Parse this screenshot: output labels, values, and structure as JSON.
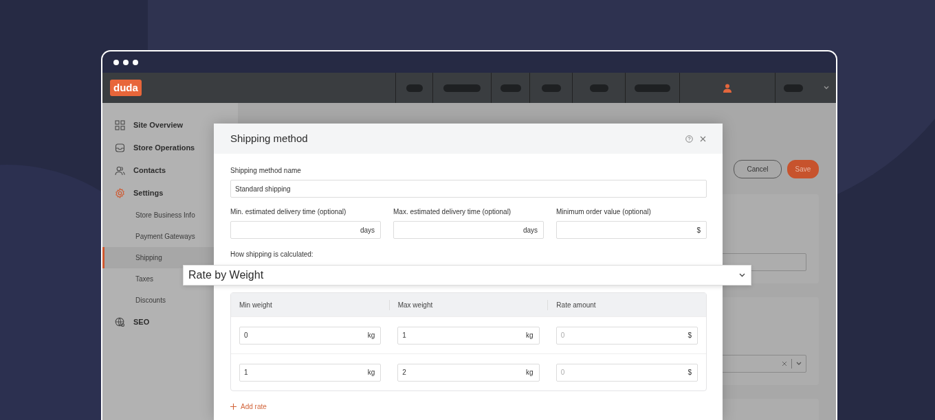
{
  "app_header": {
    "logo": "duda"
  },
  "sidebar": {
    "items": [
      {
        "label": "Site Overview",
        "active": false
      },
      {
        "label": "Store Operations",
        "active": false
      },
      {
        "label": "Contacts",
        "active": false
      },
      {
        "label": "Settings",
        "active": true,
        "children": [
          {
            "label": "Store Business Info",
            "selected": false
          },
          {
            "label": "Payment Gateways",
            "selected": false
          },
          {
            "label": "Shipping",
            "selected": true
          },
          {
            "label": "Taxes",
            "selected": false
          },
          {
            "label": "Discounts",
            "selected": false
          }
        ]
      },
      {
        "label": "SEO",
        "active": false
      }
    ]
  },
  "page": {
    "buttons": [
      {
        "label": "Cancel",
        "kind": "secondary"
      },
      {
        "label": "Save",
        "kind": "primary"
      }
    ]
  },
  "modal": {
    "title": "Shipping method",
    "name_field": {
      "label": "Shipping method name",
      "value": "Standard shipping"
    },
    "fields": [
      {
        "label": "Min. estimated delivery time (optional)",
        "unit": "days"
      },
      {
        "label": "Max. estimated delivery time (optional)",
        "unit": "days"
      },
      {
        "label": "Minimum order value (optional)",
        "unit": "$"
      }
    ],
    "calculation": {
      "label": "How shipping is calculated:",
      "value": "Rate by Weight"
    },
    "rates_table": {
      "columns": [
        "Min weight",
        "Max weight",
        "Rate amount"
      ],
      "rows": [
        [
          {
            "value": "0",
            "unit": "kg"
          },
          {
            "value": "1",
            "unit": "kg"
          },
          {
            "placeholder": "0",
            "unit": "$"
          }
        ],
        [
          {
            "value": "1",
            "unit": "kg"
          },
          {
            "value": "2",
            "unit": "kg"
          },
          {
            "placeholder": "0",
            "unit": "$"
          }
        ]
      ]
    },
    "add_rate": "Add rate"
  }
}
